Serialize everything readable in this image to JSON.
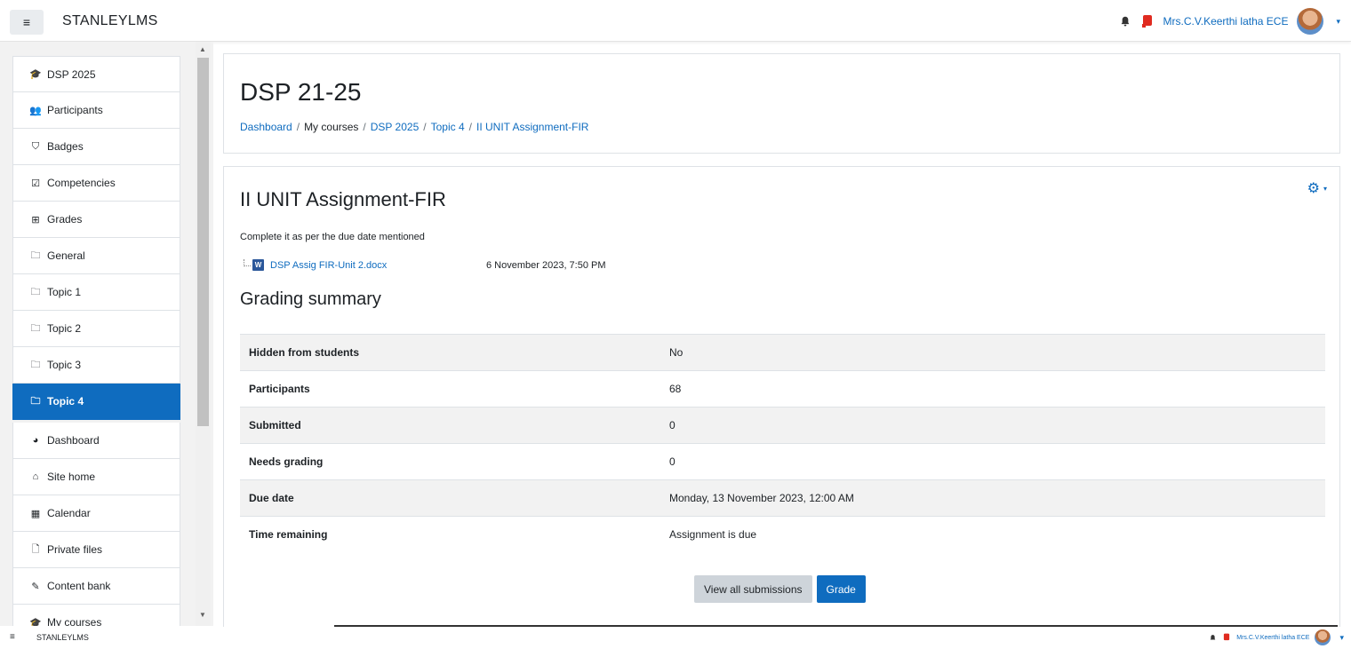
{
  "navbar": {
    "menu_icon": "hamburger-icon",
    "menu_glyph": "≡",
    "brand": "STANLEYLMS",
    "notification_icon": "bell-icon",
    "messages_icon": "message-icon",
    "user_name": "Mrs.C.V.Keerthi latha ECE",
    "user_menu_caret": "▾"
  },
  "sidebar": {
    "items": [
      {
        "label": "DSP 2025",
        "icon": "graduation-cap-icon",
        "glyph": "🎓"
      },
      {
        "label": "Participants",
        "icon": "users-icon",
        "glyph": "👥"
      },
      {
        "label": "Badges",
        "icon": "shield-icon",
        "glyph": "⛉"
      },
      {
        "label": "Competencies",
        "icon": "checkbox-icon",
        "glyph": "☑"
      },
      {
        "label": "Grades",
        "icon": "table-icon",
        "glyph": "⊞"
      },
      {
        "label": "General",
        "icon": "folder-icon",
        "glyph": "🗀"
      },
      {
        "label": "Topic 1",
        "icon": "folder-icon",
        "glyph": "🗀"
      },
      {
        "label": "Topic 2",
        "icon": "folder-icon",
        "glyph": "🗀"
      },
      {
        "label": "Topic 3",
        "icon": "folder-icon",
        "glyph": "🗀"
      },
      {
        "label": "Topic 4",
        "icon": "folder-icon",
        "glyph": "🗀",
        "active": true
      }
    ],
    "items2": [
      {
        "label": "Dashboard",
        "icon": "dashboard-icon",
        "glyph": "◕"
      },
      {
        "label": "Site home",
        "icon": "home-icon",
        "glyph": "⌂"
      },
      {
        "label": "Calendar",
        "icon": "calendar-icon",
        "glyph": "▦"
      },
      {
        "label": "Private files",
        "icon": "file-icon",
        "glyph": "🗋"
      },
      {
        "label": "Content bank",
        "icon": "brush-icon",
        "glyph": "✎"
      },
      {
        "label": "My courses",
        "icon": "graduation-cap-icon",
        "glyph": "🎓"
      }
    ]
  },
  "header": {
    "title": "DSP 21-25",
    "breadcrumb": [
      "Dashboard",
      "My courses",
      "DSP 2025",
      "Topic 4",
      "II UNIT Assignment-FIR"
    ],
    "breadcrumb_sep": "/"
  },
  "assignment": {
    "settings_icon": "gear-icon",
    "title": "II UNIT Assignment-FIR",
    "intro": "Complete it as per the due date mentioned",
    "file": {
      "icon": "word-document-icon",
      "icon_letter": "W",
      "name": "DSP Assig FIR-Unit 2.docx",
      "date": "6 November 2023, 7:50 PM"
    },
    "grading_title": "Grading summary",
    "summary": [
      {
        "label": "Hidden from students",
        "value": "No"
      },
      {
        "label": "Participants",
        "value": "68"
      },
      {
        "label": "Submitted",
        "value": "0"
      },
      {
        "label": "Needs grading",
        "value": "0"
      },
      {
        "label": "Due date",
        "value": "Monday, 13 November 2023, 12:00 AM"
      },
      {
        "label": "Time remaining",
        "value": "Assignment is due"
      }
    ],
    "buttons": {
      "view_all": "View all submissions",
      "grade": "Grade"
    }
  },
  "colors": {
    "primary": "#0f6cbf",
    "sidebar_bg": "#f2f2f2",
    "secondary_button": "#ced4da"
  }
}
